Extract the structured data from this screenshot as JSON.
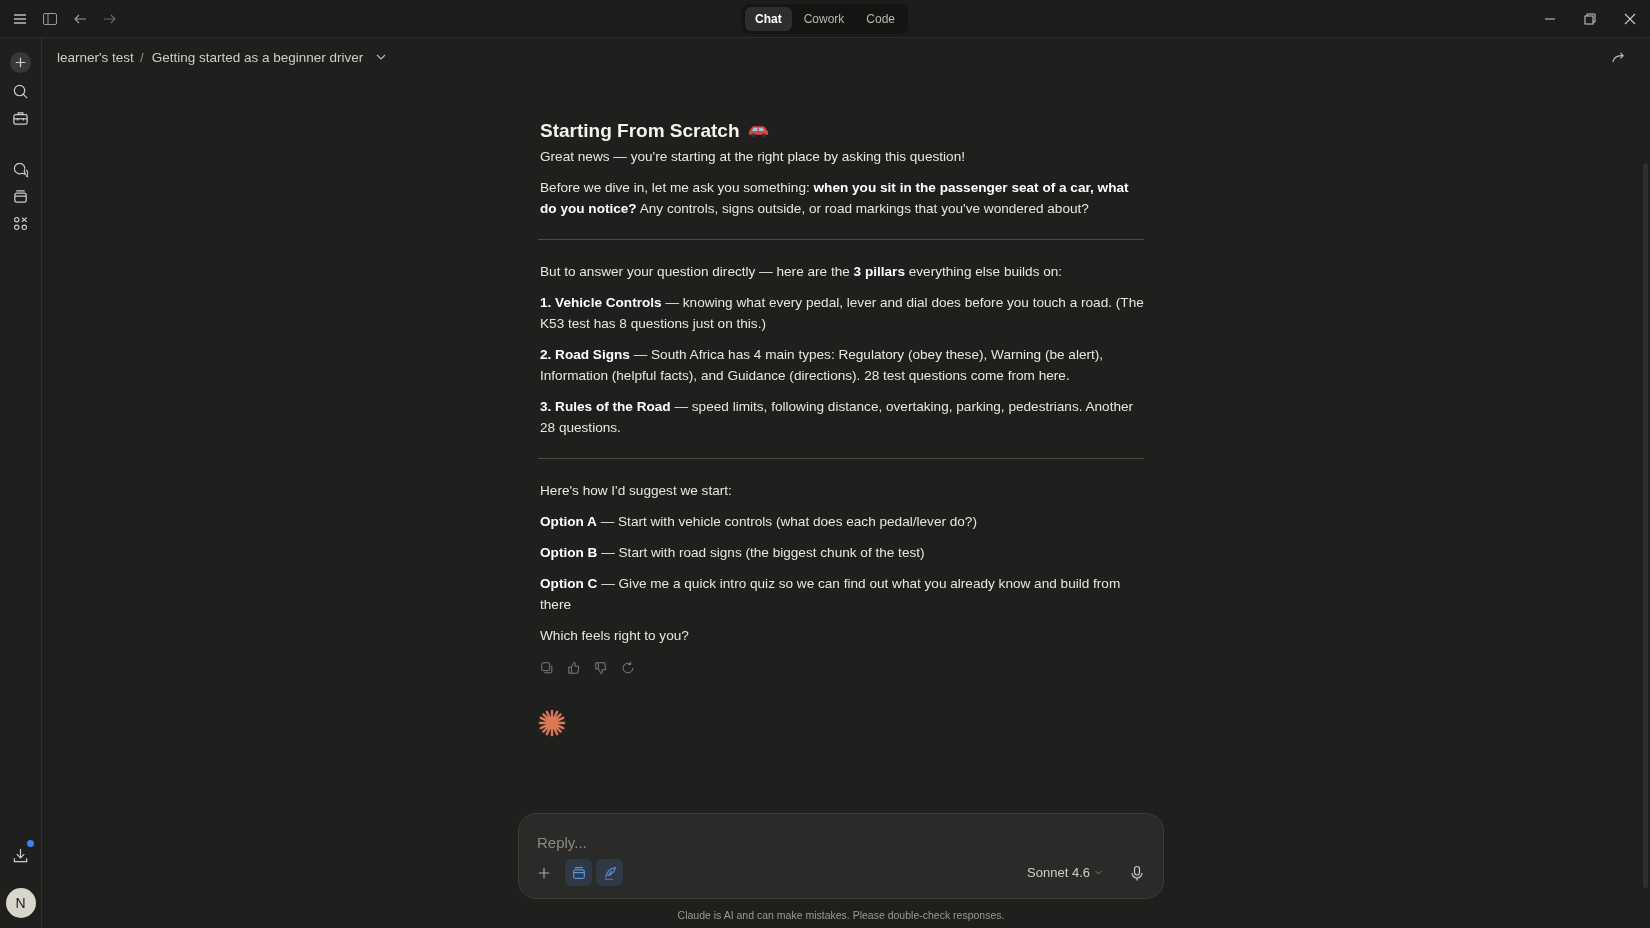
{
  "tabs": [
    {
      "label": "Chat",
      "selected": true
    },
    {
      "label": "Cowork",
      "selected": false
    },
    {
      "label": "Code",
      "selected": false
    }
  ],
  "breadcrumb": {
    "project": "learner's test",
    "separator": "/",
    "chat_title": "Getting started as a beginner driver"
  },
  "sidebar": {
    "download_notification": true,
    "avatar": "N"
  },
  "message": {
    "heading": "Starting From Scratch",
    "blocks": [
      {
        "kind": "paragraph",
        "text": "Great news — you're starting at the right place by asking this question!"
      },
      {
        "kind": "paragraph",
        "text": "Before we dive in, let me ask you something: **when you sit in the passenger seat of a car, what do you notice?** Any controls, signs outside, or road markings that you've wondered about?"
      },
      {
        "kind": "divider"
      },
      {
        "kind": "paragraph",
        "text": "But to answer your question directly — here are the **3 pillars** everything else builds on:"
      },
      {
        "kind": "paragraph",
        "text": "**1. Vehicle Controls** — knowing what every pedal, lever and dial does before you touch a road. (The K53 test has 8 questions just on this.)"
      },
      {
        "kind": "paragraph",
        "text": "**2. Road Signs** — South Africa has 4 main types: Regulatory (obey these), Warning (be alert), Information (helpful facts), and Guidance (directions). 28 test questions come from here."
      },
      {
        "kind": "paragraph",
        "text": "**3. Rules of the Road** — speed limits, following distance, overtaking, parking, pedestrians. Another 28 questions."
      },
      {
        "kind": "divider"
      },
      {
        "kind": "paragraph",
        "text": "Here's how I'd suggest we start:"
      },
      {
        "kind": "paragraph",
        "text": "**Option A** — Start with vehicle controls (what does each pedal/lever do?)"
      },
      {
        "kind": "paragraph",
        "text": "**Option B** — Start with road signs (the biggest chunk of the test)"
      },
      {
        "kind": "paragraph",
        "text": "**Option C** — Give me a quick intro quiz so we can find out what you already know and build from there"
      },
      {
        "kind": "paragraph",
        "text": "Which feels right to you?"
      }
    ]
  },
  "composer": {
    "placeholder": "Reply...",
    "tools": [
      {
        "kind": "project",
        "on": true
      },
      {
        "kind": "style",
        "on": true
      }
    ],
    "model": "Sonnet 4.6"
  },
  "disclaimer": "Claude is AI and can make mistakes. Please double-check responses."
}
